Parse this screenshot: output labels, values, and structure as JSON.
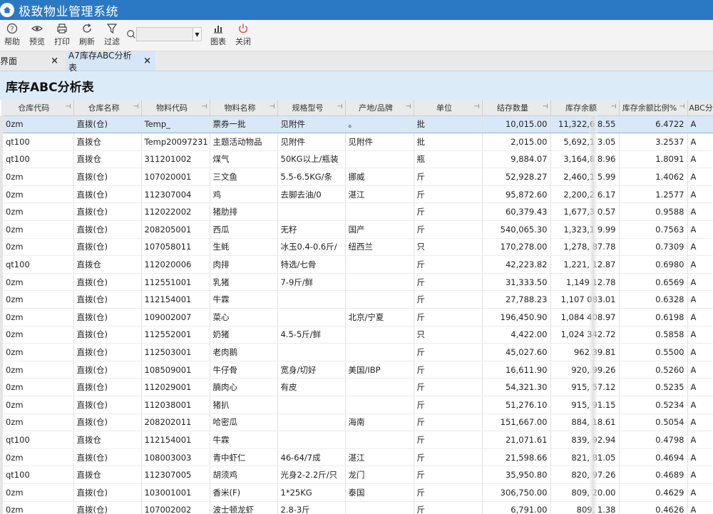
{
  "app": {
    "title": "极致物业管理系统"
  },
  "toolbar": {
    "buttons": [
      {
        "id": "help",
        "label": "帮助"
      },
      {
        "id": "preview",
        "label": "预览"
      },
      {
        "id": "print",
        "label": "打印"
      },
      {
        "id": "refresh",
        "label": "刷新"
      },
      {
        "id": "filter",
        "label": "过滤"
      }
    ],
    "search_value": "",
    "chart_label": "图表",
    "close_label": "关闭"
  },
  "tabs": [
    {
      "label": "主界面",
      "active": false
    },
    {
      "label": "A7库存ABC分析表",
      "active": true
    }
  ],
  "page": {
    "title": "库存ABC分析表"
  },
  "columns": [
    "仓库代码",
    "仓库名称",
    "物料代码",
    "物料名称",
    "规格型号",
    "产地/品牌",
    "单位",
    "结存数量",
    "库存余额",
    "库存余额比例%",
    "ABC分"
  ],
  "rows": [
    [
      "0zm",
      "直拨(仓)",
      "Temp_",
      "票券一批",
      "见附件",
      "。",
      "批",
      "10,015.00",
      "11,322,6 8.55",
      "6.4722",
      "A"
    ],
    [
      "qt100",
      "直拨仓",
      "Temp20097231",
      "主题活动物品",
      "见附件",
      "见附件",
      "批",
      "2,015.00",
      "5,692,1 3.05",
      "3.2537",
      "A"
    ],
    [
      "qt100",
      "直拨仓",
      "311201002",
      "煤气",
      "50KG以上/瓶装",
      "",
      "瓶",
      "9,884.07",
      "3,164,8 8.96",
      "1.8091",
      "A"
    ],
    [
      "0zm",
      "直拨(仓)",
      "107020001",
      "三文鱼",
      "5.5-6.5KG/条",
      "挪威",
      "斤",
      "52,928.27",
      "2,460,1 5.99",
      "1.4062",
      "A"
    ],
    [
      "0zm",
      "直拨(仓)",
      "112307004",
      "鸡",
      "去脚去油/0",
      "湛江",
      "斤",
      "95,872.60",
      "2,200,2 6.17",
      "1.2577",
      "A"
    ],
    [
      "0zm",
      "直拨(仓)",
      "112022002",
      "猪肋排",
      "",
      "",
      "斤",
      "60,379.43",
      "1,677,3 0.57",
      "0.9588",
      "A"
    ],
    [
      "0zm",
      "直拨(仓)",
      "208205001",
      "西瓜",
      "无籽",
      "国产",
      "斤",
      "540,065.30",
      "1,323,1 9.99",
      "0.7563",
      "A"
    ],
    [
      "0zm",
      "直拨(仓)",
      "107058011",
      "生蚝",
      "冰玉0.4-0.6斤/",
      "纽西兰",
      "只",
      "170,278.00",
      "1,278, 87.78",
      "0.7309",
      "A"
    ],
    [
      "qt100",
      "直拨仓",
      "112020006",
      "肉排",
      "特选/七骨",
      "",
      "斤",
      "42,223.82",
      "1,221, 12.87",
      "0.6980",
      "A"
    ],
    [
      "0zm",
      "直拨(仓)",
      "112551001",
      "乳猪",
      "7-9斤/鲜",
      "",
      "斤",
      "31,333.50",
      "1,149 12.78",
      "0.6569",
      "A"
    ],
    [
      "0zm",
      "直拨(仓)",
      "112154001",
      "牛霖",
      "",
      "",
      "斤",
      "27,788.23",
      "1,107 083.01",
      "0.6328",
      "A"
    ],
    [
      "0zm",
      "直拨(仓)",
      "109002007",
      "菜心",
      "",
      "北京/宁夏",
      "斤",
      "196,450.90",
      "1,084 408.97",
      "0.6198",
      "A"
    ],
    [
      "0zm",
      "直拨(仓)",
      "112552001",
      "奶猪",
      "4.5-5斤/鲜",
      "",
      "只",
      "4,422.00",
      "1,024 342.72",
      "0.5858",
      "A"
    ],
    [
      "0zm",
      "直拨(仓)",
      "112503001",
      "老肉鹅",
      "",
      "",
      "斤",
      "45,027.60",
      "962 39.81",
      "0.5500",
      "A"
    ],
    [
      "0zm",
      "直拨(仓)",
      "108509001",
      "牛仔骨",
      "宽身/切好",
      "美国/IBP",
      "斤",
      "16,611.90",
      "920, 99.26",
      "0.5260",
      "A"
    ],
    [
      "0zm",
      "直拨(仓)",
      "112029001",
      "腩肉心",
      "有皮",
      "",
      "斤",
      "54,321.30",
      "915, 57.12",
      "0.5235",
      "A"
    ],
    [
      "0zm",
      "直拨(仓)",
      "112038001",
      "猪扒",
      "",
      "",
      "斤",
      "51,276.10",
      "915, 91.15",
      "0.5234",
      "A"
    ],
    [
      "0zm",
      "直拨(仓)",
      "208202011",
      "哈密瓜",
      "",
      "海南",
      "斤",
      "151,667.00",
      "884, 18.61",
      "0.5054",
      "A"
    ],
    [
      "qt100",
      "直拨仓",
      "112154001",
      "牛霖",
      "",
      "",
      "斤",
      "21,071.61",
      "839, 92.94",
      "0.4798",
      "A"
    ],
    [
      "0zm",
      "直拨(仓)",
      "108003003",
      "青中虾仁",
      "46-64/7成",
      "湛江",
      "斤",
      "21,598.66",
      "821, 81.05",
      "0.4694",
      "A"
    ],
    [
      "qt100",
      "直拨仓",
      "112307005",
      "胡须鸡",
      "光身2-2.2斤/只",
      "龙门",
      "斤",
      "35,950.80",
      "820, 97.26",
      "0.4689",
      "A"
    ],
    [
      "0zm",
      "直拨(仓)",
      "103001001",
      "香米(F)",
      "1*25KG",
      "泰国",
      "斤",
      "306,750.00",
      "809, 20.00",
      "0.4629",
      "A"
    ],
    [
      "0zm",
      "直拨(仓)",
      "107002002",
      "波士顿龙虾",
      "2.8-3斤",
      "",
      "斤",
      "6,791.00",
      "809, 1.38",
      "0.4626",
      "A"
    ]
  ],
  "colors": {
    "titlebar": "#2b78c4",
    "header_band": "#dcebf8",
    "selected_row": "#d8e8f8"
  }
}
